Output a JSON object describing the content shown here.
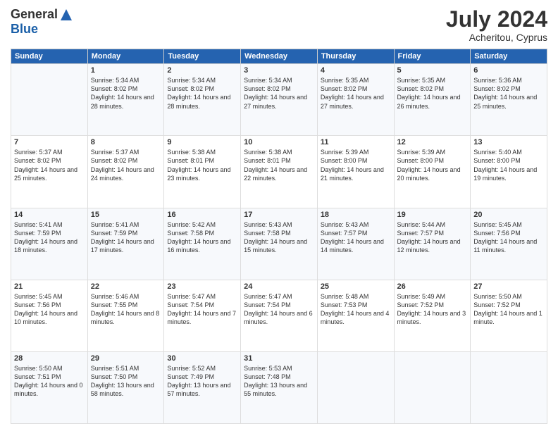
{
  "header": {
    "logo_general": "General",
    "logo_blue": "Blue",
    "month": "July 2024",
    "location": "Acheritou, Cyprus"
  },
  "days_of_week": [
    "Sunday",
    "Monday",
    "Tuesday",
    "Wednesday",
    "Thursday",
    "Friday",
    "Saturday"
  ],
  "weeks": [
    [
      {
        "num": "",
        "sunrise": "",
        "sunset": "",
        "daylight": ""
      },
      {
        "num": "1",
        "sunrise": "Sunrise: 5:34 AM",
        "sunset": "Sunset: 8:02 PM",
        "daylight": "Daylight: 14 hours and 28 minutes."
      },
      {
        "num": "2",
        "sunrise": "Sunrise: 5:34 AM",
        "sunset": "Sunset: 8:02 PM",
        "daylight": "Daylight: 14 hours and 28 minutes."
      },
      {
        "num": "3",
        "sunrise": "Sunrise: 5:34 AM",
        "sunset": "Sunset: 8:02 PM",
        "daylight": "Daylight: 14 hours and 27 minutes."
      },
      {
        "num": "4",
        "sunrise": "Sunrise: 5:35 AM",
        "sunset": "Sunset: 8:02 PM",
        "daylight": "Daylight: 14 hours and 27 minutes."
      },
      {
        "num": "5",
        "sunrise": "Sunrise: 5:35 AM",
        "sunset": "Sunset: 8:02 PM",
        "daylight": "Daylight: 14 hours and 26 minutes."
      },
      {
        "num": "6",
        "sunrise": "Sunrise: 5:36 AM",
        "sunset": "Sunset: 8:02 PM",
        "daylight": "Daylight: 14 hours and 25 minutes."
      }
    ],
    [
      {
        "num": "7",
        "sunrise": "Sunrise: 5:37 AM",
        "sunset": "Sunset: 8:02 PM",
        "daylight": "Daylight: 14 hours and 25 minutes."
      },
      {
        "num": "8",
        "sunrise": "Sunrise: 5:37 AM",
        "sunset": "Sunset: 8:02 PM",
        "daylight": "Daylight: 14 hours and 24 minutes."
      },
      {
        "num": "9",
        "sunrise": "Sunrise: 5:38 AM",
        "sunset": "Sunset: 8:01 PM",
        "daylight": "Daylight: 14 hours and 23 minutes."
      },
      {
        "num": "10",
        "sunrise": "Sunrise: 5:38 AM",
        "sunset": "Sunset: 8:01 PM",
        "daylight": "Daylight: 14 hours and 22 minutes."
      },
      {
        "num": "11",
        "sunrise": "Sunrise: 5:39 AM",
        "sunset": "Sunset: 8:00 PM",
        "daylight": "Daylight: 14 hours and 21 minutes."
      },
      {
        "num": "12",
        "sunrise": "Sunrise: 5:39 AM",
        "sunset": "Sunset: 8:00 PM",
        "daylight": "Daylight: 14 hours and 20 minutes."
      },
      {
        "num": "13",
        "sunrise": "Sunrise: 5:40 AM",
        "sunset": "Sunset: 8:00 PM",
        "daylight": "Daylight: 14 hours and 19 minutes."
      }
    ],
    [
      {
        "num": "14",
        "sunrise": "Sunrise: 5:41 AM",
        "sunset": "Sunset: 7:59 PM",
        "daylight": "Daylight: 14 hours and 18 minutes."
      },
      {
        "num": "15",
        "sunrise": "Sunrise: 5:41 AM",
        "sunset": "Sunset: 7:59 PM",
        "daylight": "Daylight: 14 hours and 17 minutes."
      },
      {
        "num": "16",
        "sunrise": "Sunrise: 5:42 AM",
        "sunset": "Sunset: 7:58 PM",
        "daylight": "Daylight: 14 hours and 16 minutes."
      },
      {
        "num": "17",
        "sunrise": "Sunrise: 5:43 AM",
        "sunset": "Sunset: 7:58 PM",
        "daylight": "Daylight: 14 hours and 15 minutes."
      },
      {
        "num": "18",
        "sunrise": "Sunrise: 5:43 AM",
        "sunset": "Sunset: 7:57 PM",
        "daylight": "Daylight: 14 hours and 14 minutes."
      },
      {
        "num": "19",
        "sunrise": "Sunrise: 5:44 AM",
        "sunset": "Sunset: 7:57 PM",
        "daylight": "Daylight: 14 hours and 12 minutes."
      },
      {
        "num": "20",
        "sunrise": "Sunrise: 5:45 AM",
        "sunset": "Sunset: 7:56 PM",
        "daylight": "Daylight: 14 hours and 11 minutes."
      }
    ],
    [
      {
        "num": "21",
        "sunrise": "Sunrise: 5:45 AM",
        "sunset": "Sunset: 7:56 PM",
        "daylight": "Daylight: 14 hours and 10 minutes."
      },
      {
        "num": "22",
        "sunrise": "Sunrise: 5:46 AM",
        "sunset": "Sunset: 7:55 PM",
        "daylight": "Daylight: 14 hours and 8 minutes."
      },
      {
        "num": "23",
        "sunrise": "Sunrise: 5:47 AM",
        "sunset": "Sunset: 7:54 PM",
        "daylight": "Daylight: 14 hours and 7 minutes."
      },
      {
        "num": "24",
        "sunrise": "Sunrise: 5:47 AM",
        "sunset": "Sunset: 7:54 PM",
        "daylight": "Daylight: 14 hours and 6 minutes."
      },
      {
        "num": "25",
        "sunrise": "Sunrise: 5:48 AM",
        "sunset": "Sunset: 7:53 PM",
        "daylight": "Daylight: 14 hours and 4 minutes."
      },
      {
        "num": "26",
        "sunrise": "Sunrise: 5:49 AM",
        "sunset": "Sunset: 7:52 PM",
        "daylight": "Daylight: 14 hours and 3 minutes."
      },
      {
        "num": "27",
        "sunrise": "Sunrise: 5:50 AM",
        "sunset": "Sunset: 7:52 PM",
        "daylight": "Daylight: 14 hours and 1 minute."
      }
    ],
    [
      {
        "num": "28",
        "sunrise": "Sunrise: 5:50 AM",
        "sunset": "Sunset: 7:51 PM",
        "daylight": "Daylight: 14 hours and 0 minutes."
      },
      {
        "num": "29",
        "sunrise": "Sunrise: 5:51 AM",
        "sunset": "Sunset: 7:50 PM",
        "daylight": "Daylight: 13 hours and 58 minutes."
      },
      {
        "num": "30",
        "sunrise": "Sunrise: 5:52 AM",
        "sunset": "Sunset: 7:49 PM",
        "daylight": "Daylight: 13 hours and 57 minutes."
      },
      {
        "num": "31",
        "sunrise": "Sunrise: 5:53 AM",
        "sunset": "Sunset: 7:48 PM",
        "daylight": "Daylight: 13 hours and 55 minutes."
      },
      {
        "num": "",
        "sunrise": "",
        "sunset": "",
        "daylight": ""
      },
      {
        "num": "",
        "sunrise": "",
        "sunset": "",
        "daylight": ""
      },
      {
        "num": "",
        "sunrise": "",
        "sunset": "",
        "daylight": ""
      }
    ]
  ]
}
